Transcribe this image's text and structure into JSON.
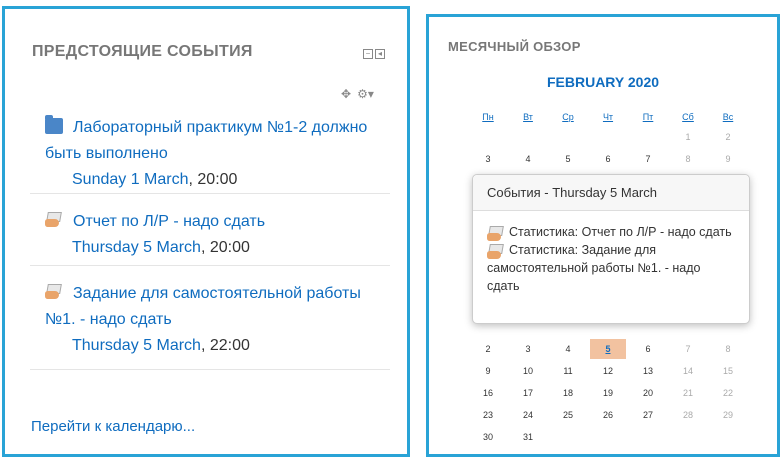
{
  "upcoming": {
    "title": "ПРЕДСТОЯЩИЕ СОБЫТИЯ",
    "events": [
      {
        "title": "Лабораторный практикум №1-2 должно быть выполнено",
        "date": "Sunday 1 March",
        "time": ", 20:00",
        "icon": "folder-icon"
      },
      {
        "title": "Отчет по Л/Р - надо сдать",
        "date": "Thursday 5 March",
        "time": ", 20:00",
        "icon": "assignment-icon"
      },
      {
        "title": "Задание для самостоятельной работы №1. - надо сдать",
        "date": "Thursday 5 March",
        "time": ", 22:00",
        "icon": "assignment-icon"
      }
    ],
    "calendar_link": "Перейти к календарю..."
  },
  "monthly": {
    "title": "МЕСЯЧНЫЙ ОБЗОР",
    "month": "FEBRUARY 2020",
    "weekdays": [
      "Пн",
      "Вт",
      "Ср",
      "Чт",
      "Пт",
      "Сб",
      "Вс"
    ],
    "visible_weeks": [
      [
        "",
        "",
        "",
        "",
        "",
        "1",
        "2"
      ],
      [
        "3",
        "4",
        "5",
        "6",
        "7",
        "8",
        "9"
      ],
      [
        "2",
        "3",
        "4",
        "5",
        "6",
        "7",
        "8"
      ],
      [
        "9",
        "10",
        "11",
        "12",
        "13",
        "14",
        "15"
      ],
      [
        "16",
        "17",
        "18",
        "19",
        "20",
        "21",
        "22"
      ],
      [
        "23",
        "24",
        "25",
        "26",
        "27",
        "28",
        "29"
      ],
      [
        "30",
        "31",
        "",
        "",
        "",
        "",
        ""
      ]
    ],
    "today": "5"
  },
  "popup": {
    "header": "События - Thursday 5 March",
    "items": [
      "Статистика: Отчет по Л/Р - надо сдать",
      "Статистика: Задание для самостоятельной работы №1. - надо сдать"
    ]
  },
  "colors": {
    "accent": "#29a3d6",
    "link": "#0f6cbf",
    "today": "#f2c2a0"
  }
}
